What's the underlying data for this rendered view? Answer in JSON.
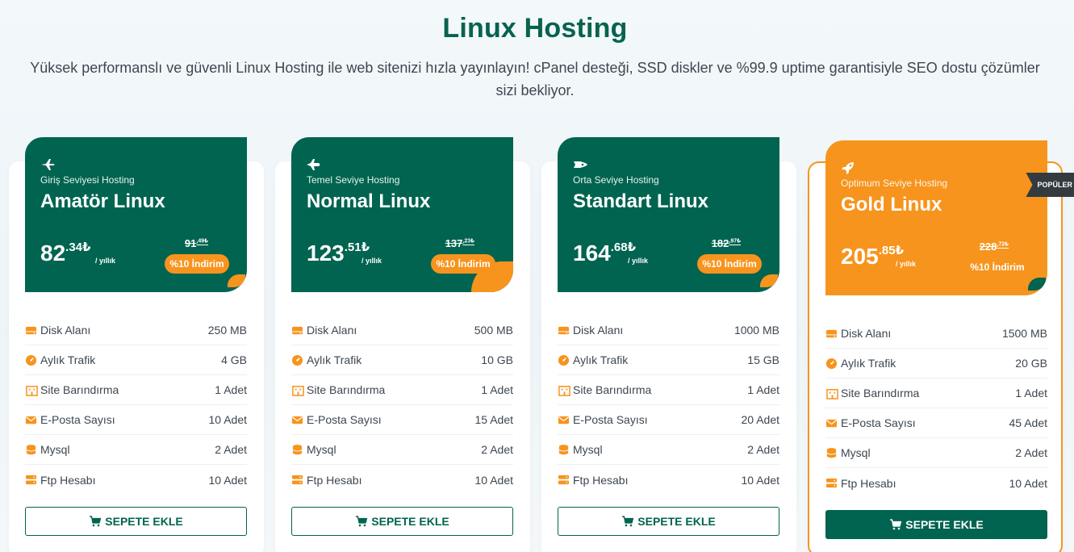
{
  "header": {
    "title": "Linux Hosting",
    "subtitle": "Yüksek performanslı ve güvenli Linux Hosting ile web sitenizi hızla yayınlayın! cPanel desteği, SSD diskler ve %99.9 uptime garantisiyle SEO dostu çözümler sizi bekliyor."
  },
  "colors": {
    "brand": "#006450",
    "accent": "#f7941d",
    "badge": "#333a40"
  },
  "plans": [
    {
      "icon": "plane-icon",
      "level": "Giriş Seviyesi Hosting",
      "name": "Amatör Linux",
      "price_int": "82",
      "price_dec": ".34",
      "currency": "₺",
      "period": "/ yıllık",
      "old_int": "91",
      "old_dec": ",49",
      "old_cur": "₺",
      "discount": "%10 İndirim",
      "features": [
        {
          "label": "Disk Alanı",
          "value": "250 MB"
        },
        {
          "label": "Aylık Trafik",
          "value": "4 GB"
        },
        {
          "label": "Site Barındırma",
          "value": "1 Adet"
        },
        {
          "label": "E-Posta Sayısı",
          "value": "10 Adet"
        },
        {
          "label": "Mysql",
          "value": "2 Adet"
        },
        {
          "label": "Ftp Hesabı",
          "value": "10 Adet"
        }
      ],
      "button": "SEPETE EKLE"
    },
    {
      "icon": "jet-icon",
      "level": "Temel Seviye Hosting",
      "name": "Normal Linux",
      "price_int": "123",
      "price_dec": ".51",
      "currency": "₺",
      "period": "/ yıllık",
      "old_int": "137",
      "old_dec": ",23",
      "old_cur": "₺",
      "discount": "%10 İndirim",
      "features": [
        {
          "label": "Disk Alanı",
          "value": "500 MB"
        },
        {
          "label": "Aylık Trafik",
          "value": "10 GB"
        },
        {
          "label": "Site Barındırma",
          "value": "1 Adet"
        },
        {
          "label": "E-Posta Sayısı",
          "value": "15 Adet"
        },
        {
          "label": "Mysql",
          "value": "2 Adet"
        },
        {
          "label": "Ftp Hesabı",
          "value": "10 Adet"
        }
      ],
      "button": "SEPETE EKLE"
    },
    {
      "icon": "space-shuttle-icon",
      "level": "Orta Seviye Hosting",
      "name": "Standart Linux",
      "price_int": "164",
      "price_dec": ".68",
      "currency": "₺",
      "period": "/ yıllık",
      "old_int": "182",
      "old_dec": ",97",
      "old_cur": "₺",
      "discount": "%10 İndirim",
      "features": [
        {
          "label": "Disk Alanı",
          "value": "1000 MB"
        },
        {
          "label": "Aylık Trafik",
          "value": "15 GB"
        },
        {
          "label": "Site Barındırma",
          "value": "1 Adet"
        },
        {
          "label": "E-Posta Sayısı",
          "value": "20 Adet"
        },
        {
          "label": "Mysql",
          "value": "2 Adet"
        },
        {
          "label": "Ftp Hesabı",
          "value": "10 Adet"
        }
      ],
      "button": "SEPETE EKLE"
    },
    {
      "icon": "rocket-icon",
      "level": "Optimum Seviye Hosting",
      "name": "Gold Linux",
      "price_int": "205",
      "price_dec": ".85",
      "currency": "₺",
      "period": "/ yıllık",
      "old_int": "228",
      "old_dec": ",72",
      "old_cur": "₺",
      "discount": "%10 İndirim",
      "badge": "POPÜLER",
      "features": [
        {
          "label": "Disk Alanı",
          "value": "1500 MB"
        },
        {
          "label": "Aylık Trafik",
          "value": "20 GB"
        },
        {
          "label": "Site Barındırma",
          "value": "1 Adet"
        },
        {
          "label": "E-Posta Sayısı",
          "value": "45 Adet"
        },
        {
          "label": "Mysql",
          "value": "2 Adet"
        },
        {
          "label": "Ftp Hesabı",
          "value": "10 Adet"
        }
      ],
      "button": "SEPETE EKLE"
    }
  ],
  "feature_icons": [
    "hdd-icon",
    "gauge-icon",
    "building-icon",
    "envelope-icon",
    "database-icon",
    "server-icon"
  ]
}
